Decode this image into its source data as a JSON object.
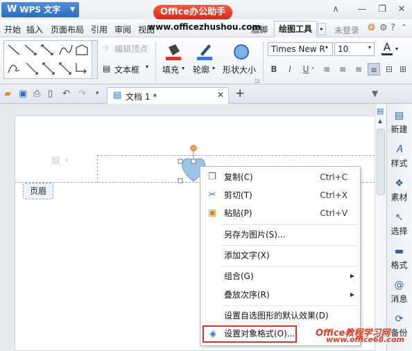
{
  "app": {
    "menu_button": "WPS 文字",
    "watermark_title": "Office办公助手",
    "watermark_url": "www.officezhushou.com",
    "login": "未登录"
  },
  "menubar": {
    "items": [
      "开始",
      "插入",
      "页面布局",
      "引用",
      "审阅",
      "视图",
      "章节",
      "眉脚"
    ],
    "active": "绘图工具"
  },
  "ribbon": {
    "edit_vertex": "编辑顶点",
    "textbox": "文本框",
    "fill": "填充",
    "outline": "轮廓",
    "shape_size": "形状大小",
    "font_name": "Times New R",
    "font_size": "10",
    "bold": "B",
    "italic": "I",
    "underline": "U"
  },
  "tabs": {
    "doc_title": "文档 1 *",
    "add": "+"
  },
  "document": {
    "header_label": "页眉"
  },
  "sidebar": {
    "items": [
      "新建",
      "样式",
      "素材",
      "选择",
      "格式",
      "消息",
      "备份"
    ]
  },
  "context_menu": {
    "items": [
      {
        "label": "复制(C)",
        "shortcut": "Ctrl+C"
      },
      {
        "label": "剪切(T)",
        "shortcut": "Ctrl+X"
      },
      {
        "label": "粘贴(P)",
        "shortcut": "Ctrl+V"
      },
      {
        "label": "另存为图片(S)..."
      },
      {
        "label": "添加文字(X)"
      },
      {
        "label": "组合(G)"
      },
      {
        "label": "叠放次序(R)"
      },
      {
        "label": "设置自选图形的默认效果(D)"
      },
      {
        "label": "设置对象格式(O)..."
      }
    ]
  },
  "watermark2": {
    "text": "Office教程学习网",
    "url": "www.office68.com"
  },
  "colors": {
    "accent": "#2f6bbf",
    "highlight": "#d9322a",
    "shape_fill": "#9dc3e6"
  }
}
